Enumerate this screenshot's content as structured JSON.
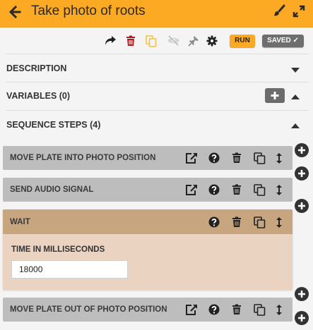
{
  "header": {
    "title": "Take photo of roots"
  },
  "toolbar": {
    "run_label": "RUN",
    "saved_label": "SAVED ✓"
  },
  "sections": {
    "description": "DESCRIPTION",
    "variables": "VARIABLES (0)",
    "sequence_steps": "SEQUENCE STEPS (4)"
  },
  "steps": [
    {
      "label": "MOVE PLATE INTO PHOTO POSITION"
    },
    {
      "label": "SEND AUDIO SIGNAL"
    },
    {
      "label": "WAIT",
      "field_label": "TIME IN MILLISECONDS",
      "field_value": "18000"
    },
    {
      "label": "MOVE PLATE OUT OF PHOTO POSITION"
    }
  ],
  "icons": {
    "header": [
      "back-arrow-icon",
      "brush-icon",
      "expand-icon"
    ],
    "toolbar": [
      "share-icon",
      "trash-icon",
      "copy-icon",
      "eye-slash-icon",
      "pin-icon",
      "gear-icon"
    ],
    "step": [
      "open-external-icon",
      "help-icon",
      "trash-icon",
      "copy-icon",
      "reorder-icon"
    ]
  },
  "colors": {
    "header_bg": "#fca923",
    "run_button": "#fca923",
    "saved_button": "#6e6e6e",
    "step_bg": "#bdbdbd",
    "wait_header": "#c6a57f",
    "wait_body": "#ead3c1",
    "delete_icon": "#b0191e",
    "copy_icon_toolbar": "#f2c94c"
  }
}
